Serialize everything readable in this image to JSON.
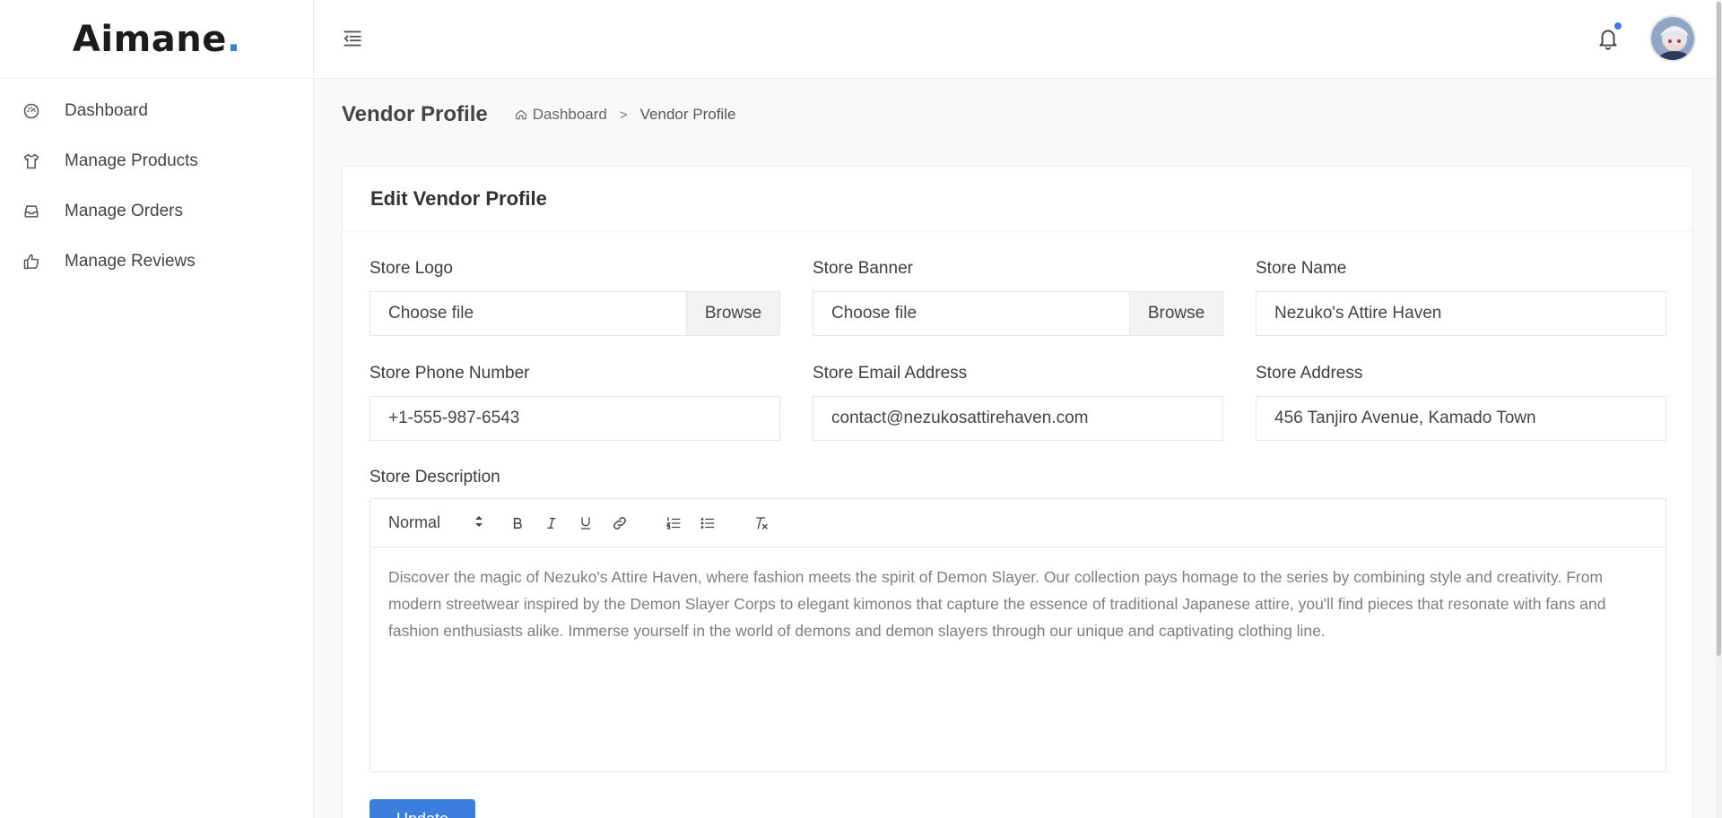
{
  "brand": {
    "name": "Aimane",
    "dot": "."
  },
  "sidebar": {
    "items": [
      {
        "label": "Dashboard",
        "icon": "dashboard-gauge-icon"
      },
      {
        "label": "Manage Products",
        "icon": "tshirt-icon"
      },
      {
        "label": "Manage Orders",
        "icon": "inbox-icon"
      },
      {
        "label": "Manage Reviews",
        "icon": "thumbs-up-icon"
      }
    ]
  },
  "topbar": {
    "notification_icon": "bell-icon",
    "has_notification": true
  },
  "page": {
    "title": "Vendor Profile",
    "breadcrumb": {
      "home": "Dashboard",
      "current": "Vendor Profile"
    }
  },
  "form": {
    "card_title": "Edit Vendor Profile",
    "store_logo": {
      "label": "Store Logo",
      "value": "Choose file",
      "button": "Browse"
    },
    "store_banner": {
      "label": "Store Banner",
      "value": "Choose file",
      "button": "Browse"
    },
    "store_name": {
      "label": "Store Name",
      "value": "Nezuko's Attire Haven"
    },
    "store_phone": {
      "label": "Store Phone Number",
      "value": "+1-555-987-6543"
    },
    "store_email": {
      "label": "Store Email Address",
      "value": "contact@nezukosattirehaven.com"
    },
    "store_address": {
      "label": "Store Address",
      "value": "456 Tanjiro Avenue, Kamado Town"
    },
    "description": {
      "label": "Store Description",
      "format": "Normal",
      "text": "Discover the magic of Nezuko's Attire Haven, where fashion meets the spirit of Demon Slayer. Our collection pays homage to the series by combining style and creativity. From modern streetwear inspired by the Demon Slayer Corps to elegant kimonos that capture the essence of traditional Japanese attire, you'll find pieces that resonate with fans and fashion enthusiasts alike. Immerse yourself in the world of demons and demon slayers through our unique and captivating clothing line."
    },
    "submit": "Update"
  },
  "colors": {
    "accent": "#3b7ddd"
  }
}
